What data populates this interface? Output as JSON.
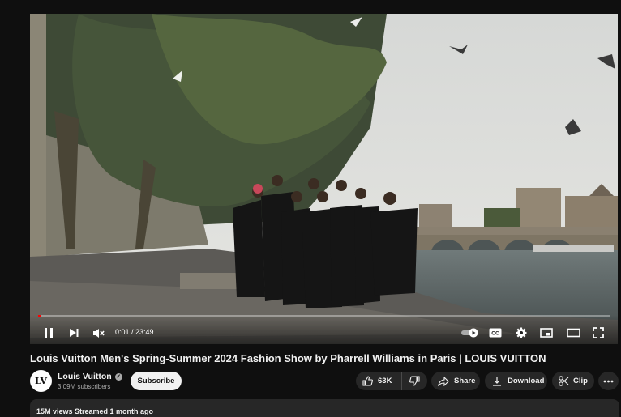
{
  "video": {
    "current_time": "0:01 / 23:49",
    "progress_fraction": 0.001
  },
  "title": "Louis Vuitton Men's Spring-Summer 2024 Fashion Show by Pharrell Williams in Paris | LOUIS VUITTON",
  "channel": {
    "avatar_text": "LV",
    "name": "Louis Vuitton",
    "subscribers": "3.09M subscribers"
  },
  "actions": {
    "subscribe": "Subscribe",
    "likes": "63K",
    "share": "Share",
    "download": "Download",
    "clip": "Clip"
  },
  "description": {
    "summary": "15M views  Streamed 1 month ago"
  },
  "icons": [
    "pause-icon",
    "next-icon",
    "mute-icon",
    "autoplay-toggle",
    "captions-icon",
    "settings-icon",
    "miniplayer-icon",
    "theater-icon",
    "fullscreen-icon",
    "like-icon",
    "dislike-icon",
    "share-icon",
    "download-icon",
    "clip-icon",
    "more-icon"
  ],
  "colors": {
    "background": "#0f0f0f",
    "pill": "#272727",
    "progress": "#ff0000"
  }
}
